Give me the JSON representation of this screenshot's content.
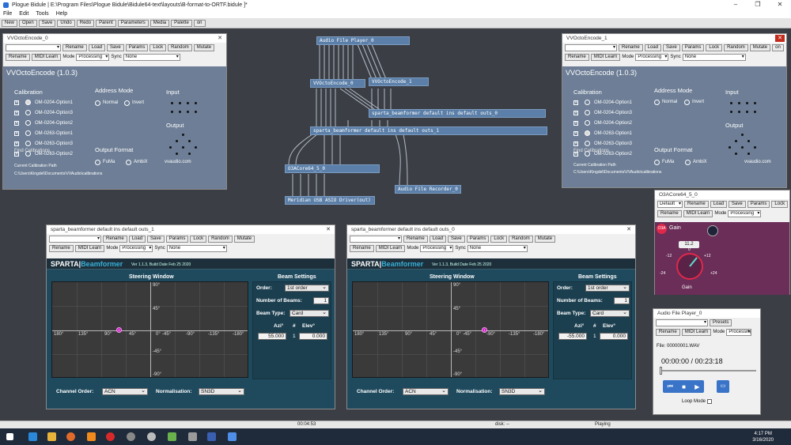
{
  "app": {
    "title": "Plogue Bidule | E:\\Program Files\\Plogue Bidule\\Bidule64-text\\layouts\\B-format-to-ORTF.bidule ]*",
    "menu": [
      "File",
      "Edit",
      "Tools",
      "Help"
    ],
    "toolbar": [
      "New",
      "Open",
      "Save",
      "Undo",
      "Redo",
      "Parent",
      "Parameters",
      "Media",
      "Palette",
      "on"
    ]
  },
  "graph": {
    "nodes": {
      "audio_file_player": "Audio File Player_0",
      "vvocto0": "VVOctoEncode_0",
      "vvocto1": "VVOctoEncode_1",
      "sparta0": "sparta_beamformer default ins default outs_0",
      "sparta1": "sparta_beamformer default ins default outs_1",
      "o3a": "O3ACore64_5_0",
      "recorder": "Audio File Recorder_0",
      "asio": "Meridian USB ASIO Driver(out)"
    }
  },
  "bidule_bar": {
    "rename": "Rename",
    "load": "Load",
    "save": "Save",
    "params": "Params",
    "lock": "Lock",
    "random": "Random",
    "mutate": "Mutate",
    "midi_learn": "MIDI Learn",
    "mode": "Mode",
    "processing": "Processing",
    "sync": "Sync",
    "none": "None",
    "default": "Default",
    "presets": "Presets"
  },
  "vvocto": {
    "win0_title": "VVOctoEncode_0",
    "win1_title": "VVOctoEncode_1",
    "heading": "VVOctoEncode (1.0.3)",
    "calibration": "Calibration",
    "address_mode": "Address Mode",
    "normal": "Normal",
    "invert": "Invert",
    "input": "Input",
    "output": "Output",
    "output_format": "Output Format",
    "fuma": "FuMa",
    "ambix": "AmbiX",
    "brand": "vvaudio.com",
    "find_cal": "Find Calibrations",
    "current_path_label": "Current Calibration Path",
    "path": "C:\\Users\\Kingdel\\Documents\\VVAudio\\calibrations",
    "options": [
      "OM-0204-Option1",
      "OM-0204-Option3",
      "OM-0204-Option2",
      "OM-0263-Option1",
      "OM-0263-Option3",
      "OM-0263-Option2"
    ]
  },
  "sparta": {
    "win1_title": "sparta_beamformer default ins default outs_1",
    "win0_title": "sparta_beamformer default ins default outs_0",
    "logo_a": "SPARTA|",
    "logo_b": "Beamformer",
    "version": "Ver 1.1.3, Build Date Feb 25 2020",
    "steering_window": "Steering Window",
    "beam_settings": "Beam Settings",
    "order_label": "Order:",
    "order_value": "1st order",
    "num_beams_label": "Number of Beams:",
    "num_beams_value": "1",
    "beam_type_label": "Beam Type:",
    "beam_type_value": "Card",
    "azi_header": "Azi°",
    "hash_header": "#",
    "elev_header": "Elev°",
    "left": {
      "azi": "55.000",
      "beam": "1",
      "elev": "0.000"
    },
    "right": {
      "azi": "-55.000",
      "beam": "1",
      "elev": "0.000"
    },
    "channel_order_label": "Channel Order:",
    "channel_order_value": "ACN",
    "normalisation_label": "Normalisation:",
    "normalisation_value": "SN3D",
    "x_ticks": [
      "180°",
      "135°",
      "90°",
      "45°",
      "0°",
      "-45°",
      "-90°",
      "-135°",
      "-180°"
    ],
    "y_ticks": [
      "90°",
      "45°",
      "-45°",
      "-90°"
    ],
    "beam_marker": "1"
  },
  "o3a": {
    "title": "O3ACore64_5_0",
    "badge": "O3A",
    "gain_title": "Gain",
    "gain_value": "11.2",
    "gain_label": "Gain",
    "ticks": [
      "-12",
      "+12",
      "-24",
      "+24",
      "0"
    ]
  },
  "player": {
    "title": "Audio File Player_0",
    "file": "File: 00000001.WAV",
    "time": "00:00:00 / 00:23:18",
    "loop_mode": "Loop Mode",
    "progress": 0.0
  },
  "status": {
    "time": "00:04:53",
    "disk": "disk: --",
    "state": "Playing"
  },
  "taskbar": {
    "time": "4:17 PM",
    "date": "3/16/2020"
  }
}
